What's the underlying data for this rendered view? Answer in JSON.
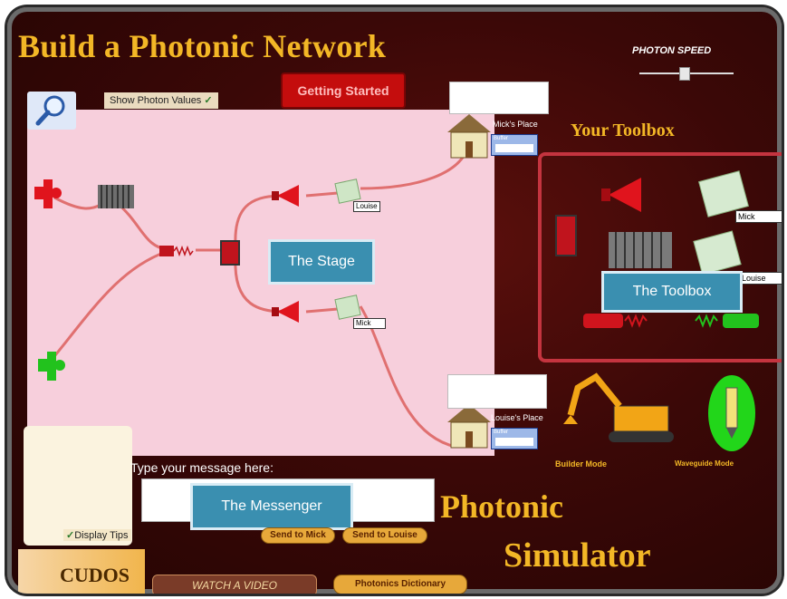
{
  "app": {
    "title": "Build a Photonic Network",
    "photon_speed_label": "PHOTON SPEED",
    "getting_started": "Getting Started",
    "show_photon_values": "Show Photon Values",
    "show_photon_values_checked": true,
    "toolbox_title": "Your Toolbox",
    "display_tips": "Display Tips",
    "display_tips_checked": true
  },
  "stage": {
    "callout": "The Stage",
    "louise_tag": "Louise",
    "mick_tag": "Mick"
  },
  "places": {
    "mick": "Mick's Place",
    "louise": "Louise's Place",
    "buffer_label": "Buffer"
  },
  "toolbox": {
    "callout": "The Toolbox",
    "tag_mick": "Mick",
    "tag_louise": "Louise"
  },
  "messenger": {
    "prompt": "Type your message here:",
    "callout": "The Messenger",
    "send_to_mick": "Send to Mick",
    "send_to_louise": "Send to Louise"
  },
  "modes": {
    "builder": "Builder Mode",
    "waveguide": "Waveguide Mode"
  },
  "footer": {
    "brand": "CUDOS",
    "watch_video": "WATCH A VIDEO",
    "dictionary": "Photonics Dictionary",
    "simulator_line1": "Photonic",
    "simulator_line2": "Simulator"
  },
  "colors": {
    "accent_gold": "#f3b726",
    "stage_bg": "#f7cfdc",
    "waveguide": "#e07070",
    "toolbox_border": "#c4343f",
    "callout": "#3a8fb0"
  }
}
